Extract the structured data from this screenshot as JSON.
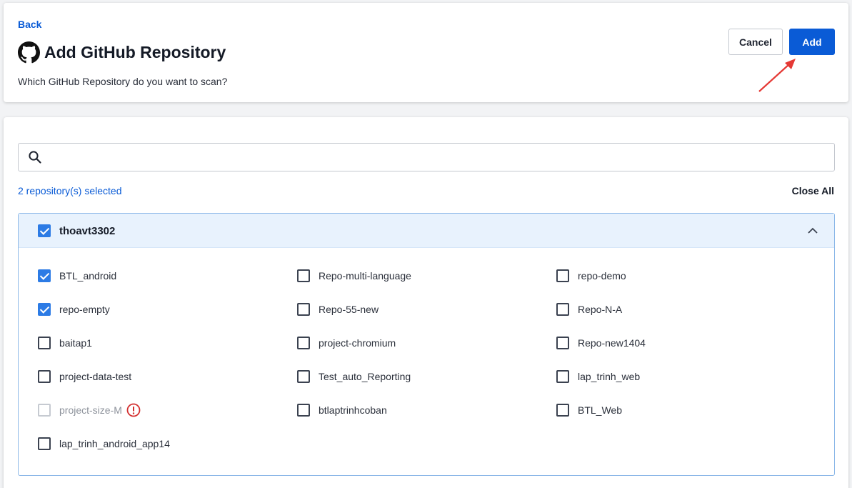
{
  "header": {
    "back_label": "Back",
    "title": "Add GitHub Repository",
    "subtitle": "Which GitHub Repository do you want to scan?",
    "cancel_label": "Cancel",
    "add_label": "Add"
  },
  "search": {
    "value": "",
    "placeholder": ""
  },
  "selection": {
    "count_text": "2 repository(s) selected",
    "close_all_label": "Close All"
  },
  "group": {
    "name": "thoavt3302",
    "checked": true,
    "expanded": true,
    "repos": [
      {
        "name": "BTL_android",
        "checked": true,
        "disabled": false
      },
      {
        "name": "Repo-multi-language",
        "checked": false,
        "disabled": false
      },
      {
        "name": "repo-demo",
        "checked": false,
        "disabled": false
      },
      {
        "name": "repo-empty",
        "checked": true,
        "disabled": false
      },
      {
        "name": "Repo-55-new",
        "checked": false,
        "disabled": false
      },
      {
        "name": "Repo-N-A",
        "checked": false,
        "disabled": false
      },
      {
        "name": "baitap1",
        "checked": false,
        "disabled": false
      },
      {
        "name": "project-chromium",
        "checked": false,
        "disabled": false
      },
      {
        "name": "Repo-new1404",
        "checked": false,
        "disabled": false
      },
      {
        "name": "project-data-test",
        "checked": false,
        "disabled": false
      },
      {
        "name": "Test_auto_Reporting",
        "checked": false,
        "disabled": false
      },
      {
        "name": "lap_trinh_web",
        "checked": false,
        "disabled": false
      },
      {
        "name": "project-size-M",
        "checked": false,
        "disabled": true,
        "warning": true
      },
      {
        "name": "btlaptrinhcoban",
        "checked": false,
        "disabled": false
      },
      {
        "name": "BTL_Web",
        "checked": false,
        "disabled": false
      },
      {
        "name": "lap_trinh_android_app14",
        "checked": false,
        "disabled": false
      }
    ]
  },
  "colors": {
    "accent": "#0a5bd6",
    "checkbox_checked": "#2c7be5",
    "group_header_bg": "#e8f2fd",
    "group_border": "#8cb8e8",
    "warning": "#d32f2f",
    "annotation_arrow": "#e53935"
  },
  "icons": {
    "title_icon": "github-icon",
    "search": "search-icon",
    "collapse": "chevron-up-icon",
    "warning": "warning-circle-icon"
  }
}
